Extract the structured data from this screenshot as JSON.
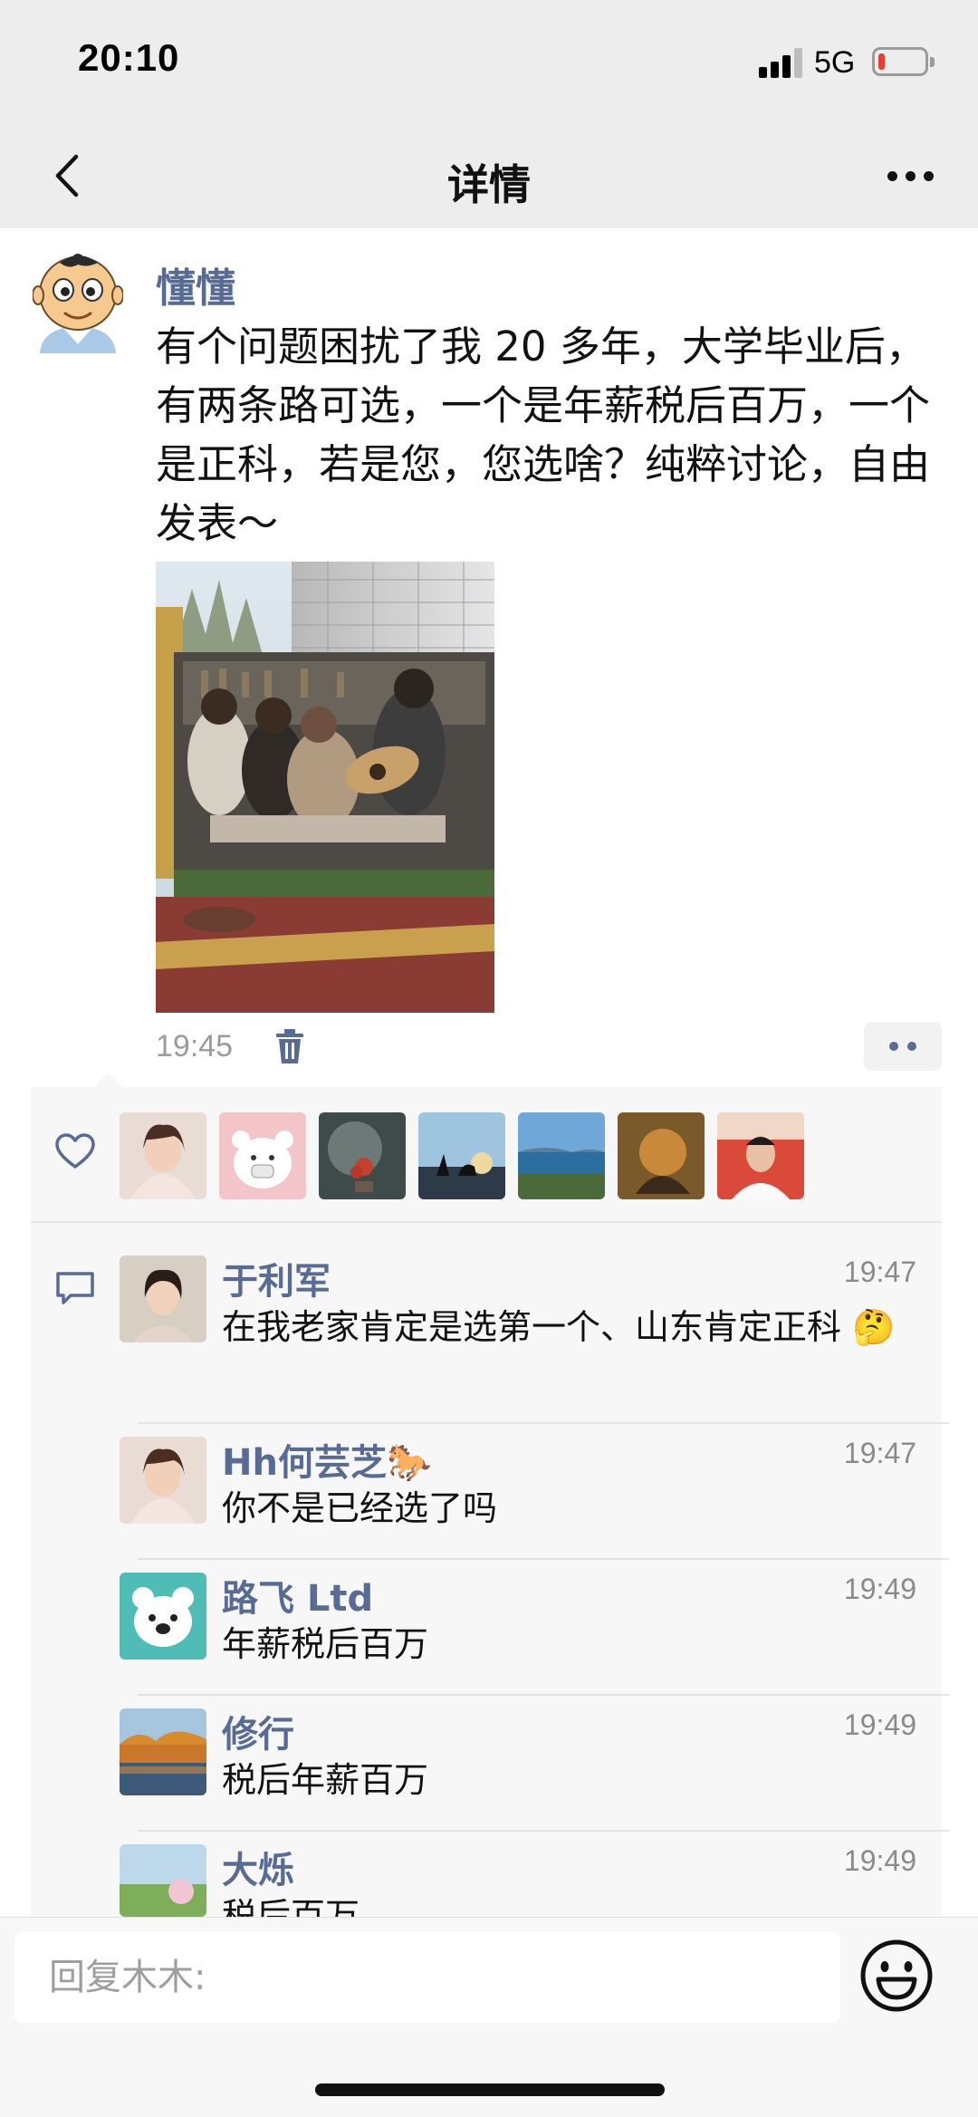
{
  "status_bar": {
    "time": "20:10",
    "network": "5G",
    "icons": [
      "signal-icon",
      "battery-icon"
    ]
  },
  "nav": {
    "title": "详情",
    "icons": [
      "back-icon",
      "more-icon"
    ]
  },
  "post": {
    "author": "懂懂",
    "text": "有个问题困扰了我 20 多年，大学毕业后，有两条路可选，一个是年薪税后百万，一个是正科，若是您，您选啥？纯粹讨论，自由发表～",
    "time": "19:45",
    "icons": [
      "delete-icon",
      "more-actions-icon"
    ]
  },
  "likes": {
    "icon": "heart-icon",
    "avatar_count": 7
  },
  "comments": [
    {
      "name": "于利军",
      "time": "19:47",
      "text": "在我老家肯定是选第一个、山东肯定正科 🤔"
    },
    {
      "name": "Hh何芸芝🐎",
      "time": "19:47",
      "text": "你不是已经选了吗"
    },
    {
      "name": "路飞 Ltd",
      "time": "19:49",
      "text": "年薪税后百万"
    },
    {
      "name": "修行",
      "time": "19:49",
      "text": "税后年薪百万"
    },
    {
      "name": "大烁",
      "time": "19:49",
      "text": "税后百万"
    }
  ],
  "reply": {
    "placeholder": "回复木木:",
    "icon": "emoji-icon"
  },
  "colors": {
    "link_blue": "#576b95",
    "panel_bg": "#f7f7f7",
    "bar_bg": "#ededed"
  }
}
